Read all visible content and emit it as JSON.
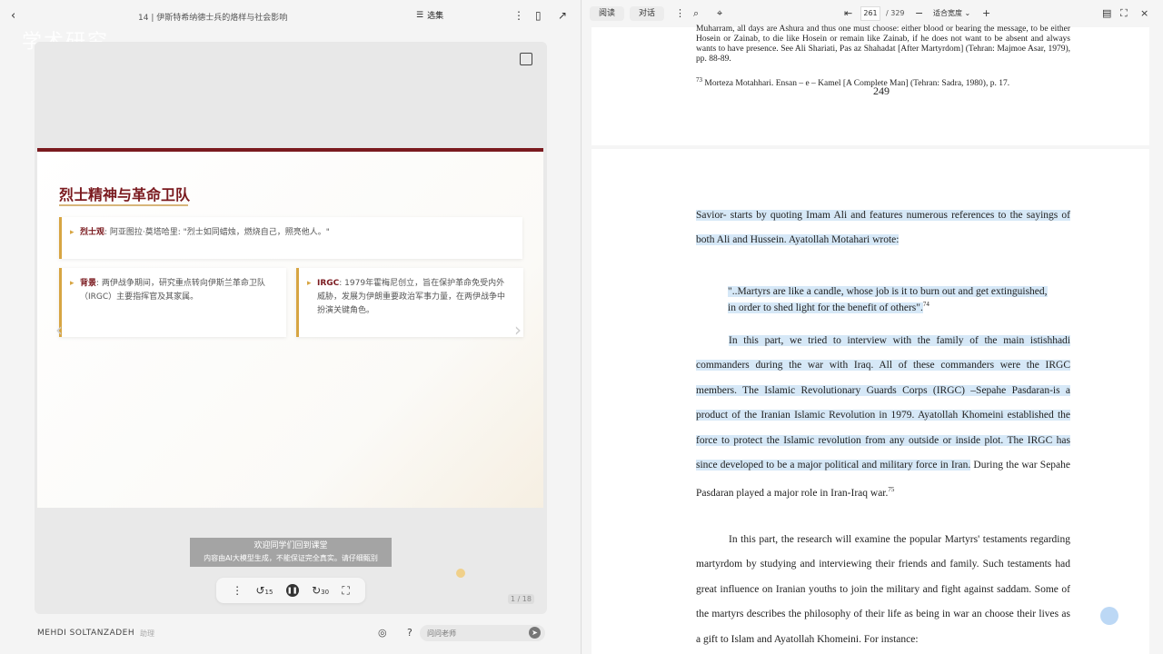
{
  "left": {
    "doc_title": "14 | 伊斯特希纳德士兵的烙样与社会影响",
    "select_label": "选集",
    "watermark": "学术研究",
    "slide": {
      "title": "烈士精神与革命卫队",
      "card1": {
        "bold": "烈士观",
        "text": ": 阿亚图拉·莫塔哈里: \"烈士如同蜡烛，燃烧自己，照亮他人。\""
      },
      "card2": {
        "bold": "背景",
        "text": ": 两伊战争期间，研究重点转向伊斯兰革命卫队（IRGC）主要指挥官及其家属。"
      },
      "card3": {
        "bold": "IRGC",
        "text": ": 1979年霍梅尼创立，旨在保护革命免受内外威胁，发展为伊朗重要政治军事力量，在两伊战争中扮演关键角色。"
      }
    },
    "subtitle_line1": "欢迎同学们回到课堂",
    "subtitle_line2": "内容由AI大模型生成，不能保证完全真实。请仔细甄别",
    "controls": {
      "rewind": "15",
      "forward": "30"
    },
    "page_counter": "1 / 18",
    "author": "MEHDI SOLTANZADEH",
    "chip": "助理",
    "ask_placeholder": "问问老师"
  },
  "right": {
    "tab_read": "阅读",
    "tab_chat": "对话",
    "current_page": "261",
    "total_pages": "329",
    "zoom": "适合宽度",
    "page1": {
      "fn_line1": "Muharram, all days are Ashura and thus one must choose: either blood or bearing the message, to be either Hosein or Zainab, to die like Hosein or remain like Zainab, if he does not want to be absent and always wants to have presence. See Ali Shariati, Pas az Shahadat [After Martyrdom] (Tehran: Majmoe Asar, 1979), pp. 88-89.",
      "fn_73_num": "73",
      "fn_73": "Morteza Motahhari. Ensan – e – Kamel [A Complete Man] (Tehran: Sadra, 1980), p. 17.",
      "page_number": "249"
    },
    "page2": {
      "para1": "Savior- starts by quoting Imam Ali and features numerous references to the sayings of both Ali and Hussein. Ayatollah Motahari wrote:",
      "quote": "\"..Martyrs are like a candle, whose job is it to burn out and get extinguished, in order to shed light for the benefit of others\".",
      "quote_ref": "74",
      "para2_hl": "In this part, we tried to interview with the family of the main istishhadi commanders during the war with Iraq. All of these commanders were the IRGC members. The Islamic Revolutionary Guards Corps (IRGC) –Sepahe Pasdaran-is a product of the Iranian Islamic Revolution in 1979. Ayatollah Khomeini established the force to protect the Islamic revolution from any outside or inside plot. The IRGC has since developed to be a major political and military force in Iran.",
      "para2_rest": " During the war Sepahe Pasdaran played  a major role in Iran-Iraq war.",
      "para2_ref": "75",
      "para3": "In this part, the research will examine the popular Martyrs' testaments regarding martyrdom by studying and interviewing their friends and family. Such testaments had great influence on Iranian youths to join the military and fight against saddam. Some of the martyrs describes the philosophy of their life as being in war an choose their lives as a gift to Islam and Ayatollah Khomeini. For instance:"
    }
  }
}
